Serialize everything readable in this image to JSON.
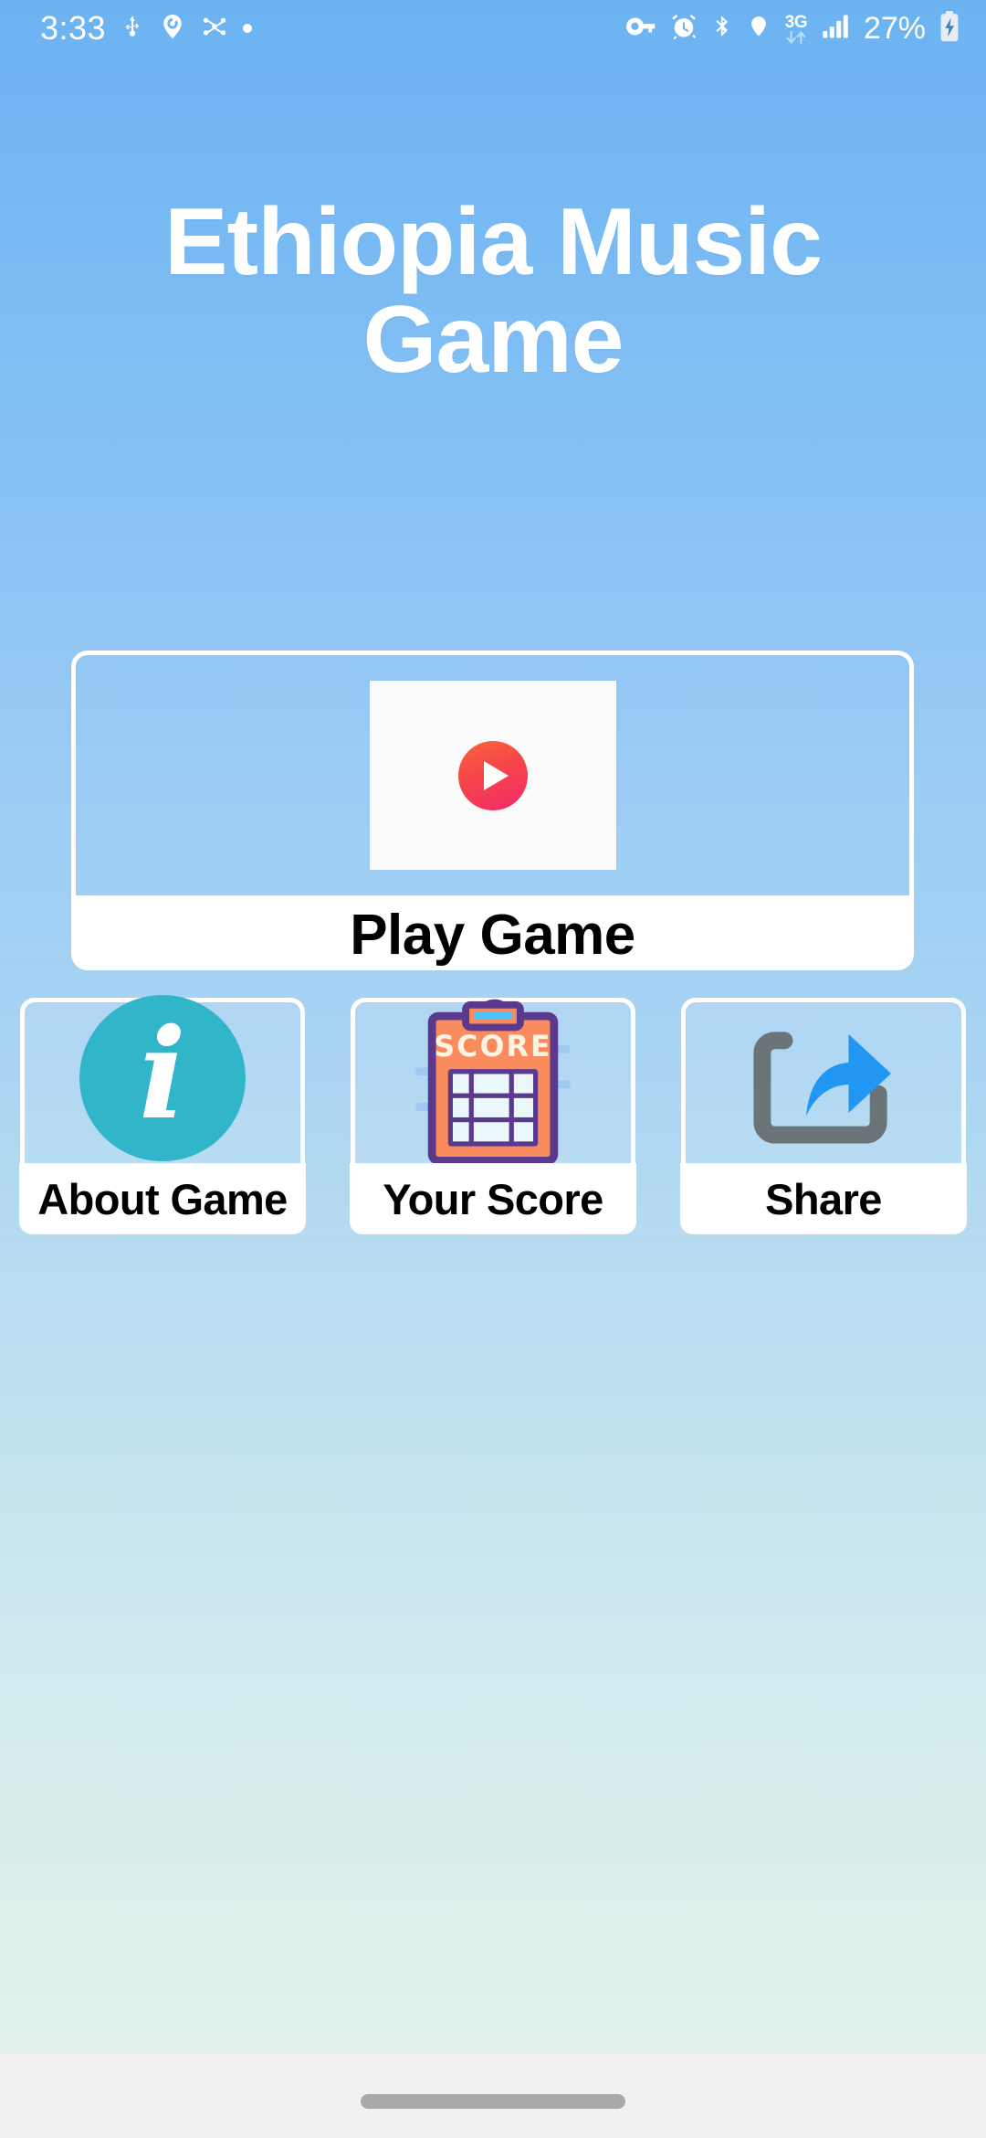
{
  "status_bar": {
    "time": "3:33",
    "battery_percent": "27%",
    "network_label": "3G",
    "left_icons": [
      "usb-icon",
      "location-share-icon",
      "bluetooth-share-icon",
      "dot-indicator-icon"
    ],
    "right_icons": [
      "vpn-key-icon",
      "alarm-icon",
      "bluetooth-icon",
      "location-icon",
      "mobile-data-3g-icon",
      "signal-bars-icon",
      "battery-charging-icon"
    ]
  },
  "app": {
    "title_line1": "Ethiopia Music",
    "title_line2": "Game"
  },
  "play_card": {
    "label": "Play Game",
    "icon": "play-circle-icon"
  },
  "tiles": [
    {
      "label": "About Game",
      "icon": "info-circle-icon",
      "letter": "i"
    },
    {
      "label": "Your Score",
      "icon": "score-clipboard-icon",
      "clipboard_text": "SCORE"
    },
    {
      "label": "Share",
      "icon": "share-arrow-icon"
    }
  ],
  "colors": {
    "bg_top": "#6cb3f2",
    "bg_bottom": "#e8f4ee",
    "card_border": "#ffffff",
    "label_text": "#000000",
    "title_text": "#ffffff",
    "about_circle": "#31b5c9",
    "score_orange": "#f98b5c",
    "score_purple": "#5b3a8e",
    "share_blue": "#2196f3",
    "share_gray": "#6b7478",
    "play_red": "#f64449"
  },
  "nav": {
    "gesture_pill": "home-gesture-pill"
  }
}
